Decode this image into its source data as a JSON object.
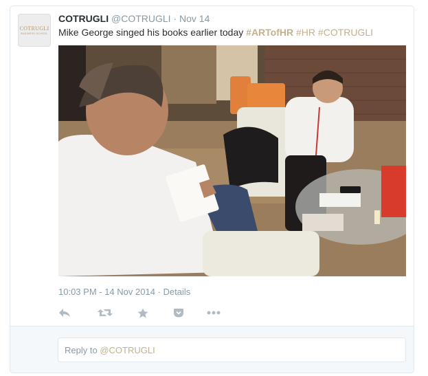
{
  "tweet": {
    "author_name": "COTRUGLI",
    "handle": "@COTRUGLI",
    "separator": "·",
    "date": "Nov 14",
    "text": "Mike George singed his books earlier today ",
    "hashtags": [
      "#ARTofHR",
      "#HR",
      "#COTRUGLI"
    ],
    "timestamp": "10:03 PM - 14 Nov 2014",
    "details_sep": "·",
    "details_label": "Details",
    "photo_icon": "photo-of-two-men-in-interview"
  },
  "avatar": {
    "logo_text": "COTRUGLI",
    "logo_subtext": "BUSINESS SCHOOL"
  },
  "actions": {
    "reply_icon": "reply-icon",
    "retweet_icon": "retweet-icon",
    "favorite_icon": "star-icon",
    "pocket_icon": "pocket-icon",
    "more_icon": "more-icon"
  },
  "reply": {
    "prefix": "Reply to ",
    "mention": "@COTRUGLI"
  },
  "colors": {
    "hashtag": "#c4b08a",
    "muted": "#8899a6",
    "text": "#292f33",
    "border": "#e1e8ed",
    "reply_bg": "#f5f8fa"
  }
}
